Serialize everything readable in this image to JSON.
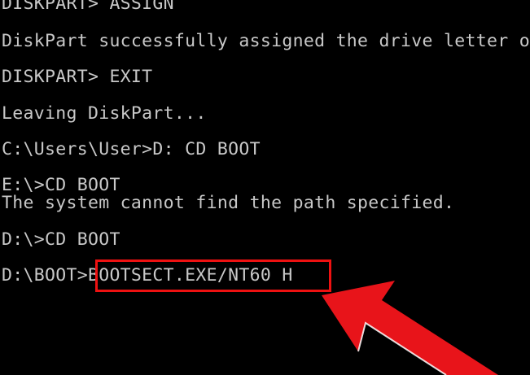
{
  "console": {
    "lines": [
      "DISKPART> ASSIGN",
      "DiskPart successfully assigned the drive letter or mount point.",
      "DISKPART> EXIT",
      "Leaving DiskPart...",
      "C:\\Users\\User>D: CD BOOT",
      "E:\\>CD BOOT",
      "The system cannot find the path specified.",
      "D:\\>CD BOOT"
    ],
    "prompt": "D:\\BOOT>",
    "highlighted_command": "BOOTSECT.EXE/NT60 H"
  },
  "annotation": {
    "highlight_color": "#ee1111",
    "arrow_icon": "red-arrow-icon"
  },
  "colors": {
    "background": "#000000",
    "text": "#c8c8c8"
  }
}
